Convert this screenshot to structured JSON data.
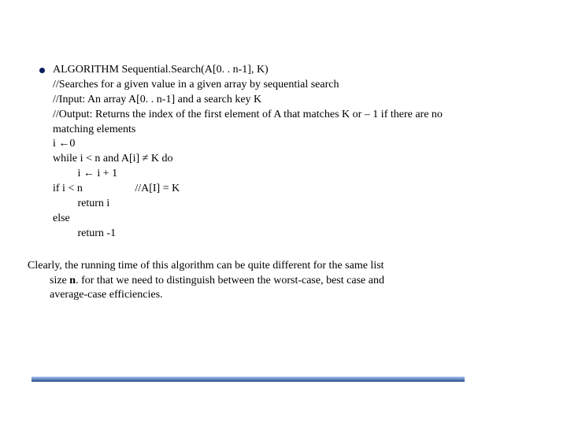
{
  "algo": {
    "title": "ALGORITHM Sequential.Search(A[0. . n-1], K)",
    "c1": "//Searches for a given value in a given array by sequential search",
    "c2": "//Input: An array A[0. . n-1] and a search key K",
    "c3": "//Output: Returns the index of the first element of A that matches K or – 1 if there are no",
    "c3b": "matching elements",
    "l1": "i ←0",
    "l2": "while i < n and A[i] ≠ K do",
    "l3": "         i ← i + 1",
    "l4": "if i < n                   //A[I] = K",
    "l5": "         return i",
    "l6": "else",
    "l7": "         return -1"
  },
  "summary": {
    "s1_a": "Clearly, the running time of this algorithm can be quite different for the same list",
    "s1_b_prefix": "size",
    "s1_b_bold": " n",
    "s1_b_rest": ". for that we need to distinguish between the worst-case, best case and",
    "s1_c": "average-case efficiencies."
  }
}
